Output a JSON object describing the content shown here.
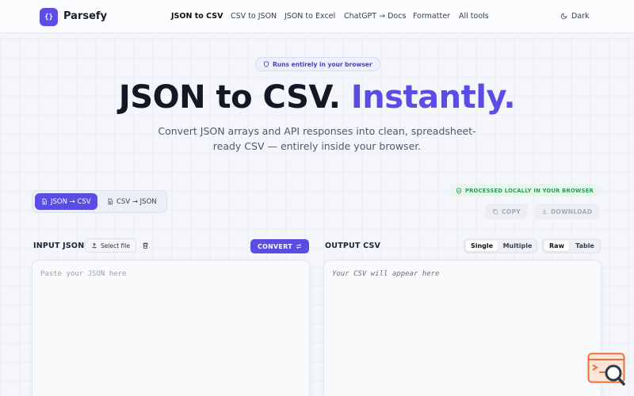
{
  "header": {
    "logo_glyph": "{}",
    "brand": "Parsefy",
    "nav": [
      {
        "label": "JSON to CSV",
        "active": true
      },
      {
        "label": "CSV to JSON",
        "active": false
      },
      {
        "label": "JSON to Excel",
        "active": false
      },
      {
        "label": "ChatGPT → Docs",
        "active": false
      },
      {
        "label": "Formatter",
        "active": false
      },
      {
        "label": "All tools",
        "active": false
      }
    ],
    "theme_label": "Dark",
    "theme_icon": "moon-icon"
  },
  "hero": {
    "badge": "Runs entirely in your browser",
    "badge_icon": "shield-icon",
    "title_main": "JSON to CSV.",
    "title_accent": "Instantly.",
    "subtitle": "Convert JSON arrays and API responses into clean, spreadsheet-ready CSV — entirely inside your browser."
  },
  "mode": {
    "options": [
      {
        "label": "JSON → CSV",
        "selected": true,
        "icon": "file-icon"
      },
      {
        "label": "CSV → JSON",
        "selected": false,
        "icon": "file-icon"
      }
    ]
  },
  "status": {
    "processed": "PROCESSED LOCALLY IN YOUR BROWSER",
    "processed_icon": "shield-check-icon"
  },
  "actions": {
    "copy": "COPY",
    "copy_icon": "copy-icon",
    "download": "DOWNLOAD",
    "download_icon": "download-icon"
  },
  "input": {
    "label": "INPUT JSON",
    "select_file": "Select file",
    "select_file_icon": "upload-icon",
    "clear_icon": "trash-icon",
    "convert": "CONVERT",
    "convert_icon": "swap-icon",
    "placeholder": "Paste your JSON here",
    "value": ""
  },
  "output": {
    "label": "OUTPUT CSV",
    "row_mode": [
      {
        "label": "Single",
        "selected": true
      },
      {
        "label": "Multiple",
        "selected": false
      }
    ],
    "view_mode": [
      {
        "label": "Raw",
        "selected": true
      },
      {
        "label": "Table",
        "selected": false
      }
    ],
    "placeholder": "Your CSV will appear here"
  },
  "widget": {
    "icon": "search-window-icon"
  },
  "colors": {
    "accent": "#5a4de4",
    "success": "#2a9b55",
    "background": "#f4f6fb",
    "widget_orange": "#e8723a"
  }
}
